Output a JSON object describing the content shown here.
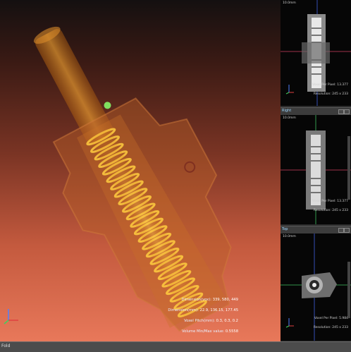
{
  "main_view": {
    "info_lines": [
      {
        "label": "Dimension(vox)",
        "value": "339, 580, 449"
      },
      {
        "label": "Dimension(mm)",
        "value": "22.9, 136.15, 177.45"
      },
      {
        "label": "Voxel Pitch(mm)",
        "value": "0.3, 0.3, 0.2"
      },
      {
        "label": "Volume Min/Max value",
        "value": "0.5558"
      }
    ]
  },
  "side_panel": {
    "viewports": [
      {
        "name": "top-view",
        "scale": "10.0mm",
        "voxel_per_pixel": "Voxel Per Pixel: 13.377",
        "resolution": "Resolution: 245 x 233",
        "has_bar": false
      },
      {
        "name": "right-view",
        "bar_label": "Right",
        "scale": "10.0mm",
        "voxel_per_pixel": "Voxel Per Pixel: 13.377",
        "resolution": "Resolution: 245 x 233",
        "has_bar": true
      },
      {
        "name": "front-view",
        "bar_label": "Top",
        "scale": "10.0mm",
        "voxel_per_pixel": "Voxel Per Pixel: 5.984",
        "resolution": "Resolution: 245 x 233",
        "has_bar": true
      }
    ]
  },
  "status_bar": {
    "text": "Fold"
  },
  "colors": {
    "model_glow": "#ffb020",
    "background_top": "#141010",
    "background_bottom": "#e8785a",
    "crosshair_red": "#d04060",
    "crosshair_green": "#40c060",
    "crosshair_blue": "#4060e0"
  },
  "icons": {
    "axis": "xyz-axis-icon",
    "pin": "pin-icon",
    "maximize": "maximize-icon"
  }
}
